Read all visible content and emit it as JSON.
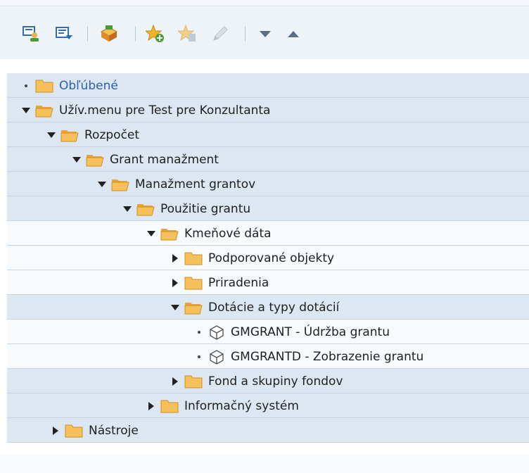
{
  "toolbar": {
    "buttons": [
      {
        "name": "user-menu-button",
        "icon": "user-menu-icon"
      },
      {
        "name": "sap-menu-button",
        "icon": "sap-menu-icon"
      },
      {
        "name": "business-workplace-button",
        "icon": "inbox-icon"
      },
      {
        "name": "add-to-favorites-button",
        "icon": "star-add-icon"
      },
      {
        "name": "delete-favorite-button",
        "icon": "star-delete-icon"
      },
      {
        "name": "change-favorite-button",
        "icon": "pencil-icon"
      },
      {
        "name": "move-down-button",
        "icon": "triangle-down-icon"
      },
      {
        "name": "move-up-button",
        "icon": "triangle-up-icon"
      }
    ]
  },
  "tree": {
    "rows": [
      {
        "label": "Obľúbené",
        "level": 0,
        "arrow": "dot",
        "icon": "folder-closed"
      },
      {
        "label": "Užív.menu pre Test pre Konzultanta",
        "level": 0,
        "arrow": "down",
        "icon": "folder-open"
      },
      {
        "label": "Rozpočet",
        "level": 1,
        "arrow": "down",
        "icon": "folder-open"
      },
      {
        "label": "Grant manažment",
        "level": 2,
        "arrow": "down",
        "icon": "folder-open"
      },
      {
        "label": "Manažment grantov",
        "level": 3,
        "arrow": "down",
        "icon": "folder-open"
      },
      {
        "label": "Použitie grantu",
        "level": 4,
        "arrow": "down",
        "icon": "folder-open"
      },
      {
        "label": "Kmeňové dáta",
        "level": 5,
        "arrow": "down",
        "icon": "folder-open"
      },
      {
        "label": "Podporované objekty",
        "level": 6,
        "arrow": "right",
        "icon": "folder-closed"
      },
      {
        "label": "Priradenia",
        "level": 6,
        "arrow": "right",
        "icon": "folder-closed"
      },
      {
        "label": "Dotácie a typy dotácií",
        "level": 6,
        "arrow": "down",
        "icon": "folder-open"
      },
      {
        "label": "GMGRANT - Údržba grantu",
        "level": 7,
        "arrow": "dot",
        "icon": "transaction-cube"
      },
      {
        "label": "GMGRANTD - Zobrazenie grantu",
        "level": 7,
        "arrow": "dot",
        "icon": "transaction-cube"
      },
      {
        "label": "Fond a skupiny fondov",
        "level": 6,
        "arrow": "right",
        "icon": "folder-closed"
      },
      {
        "label": "Informačný systém",
        "level": 5,
        "arrow": "right",
        "icon": "folder-closed"
      },
      {
        "label": "Nástroje",
        "level": 1,
        "arrow": "right",
        "icon": "folder-closed"
      }
    ]
  }
}
